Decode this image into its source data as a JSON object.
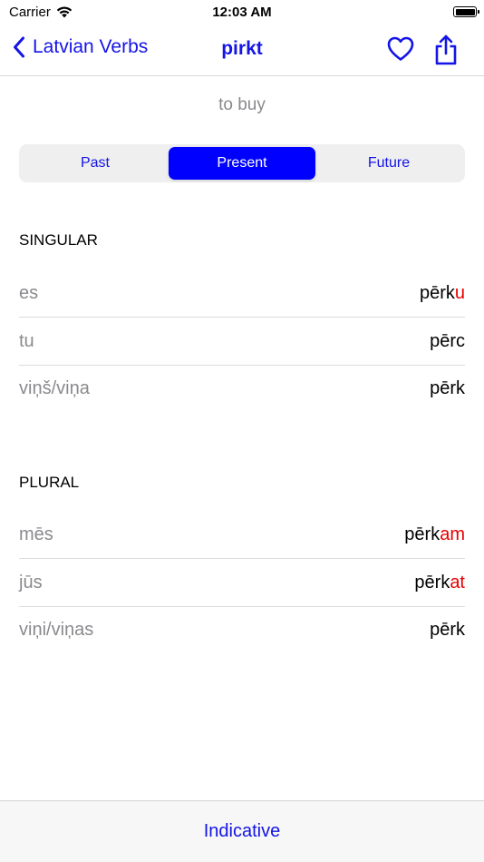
{
  "status_bar": {
    "carrier": "Carrier",
    "time": "12:03 AM"
  },
  "nav": {
    "back_label": "Latvian Verbs",
    "title": "pirkt"
  },
  "verb": {
    "translation": "to buy"
  },
  "tenses": {
    "past": "Past",
    "present": "Present",
    "future": "Future",
    "selected": "present"
  },
  "singular": {
    "header": "SINGULAR",
    "rows": [
      {
        "pronoun": "es",
        "stem": "pērk",
        "ending": "u"
      },
      {
        "pronoun": "tu",
        "stem": "pērc",
        "ending": ""
      },
      {
        "pronoun": "viņš/viņa",
        "stem": "pērk",
        "ending": ""
      }
    ]
  },
  "plural": {
    "header": "PLURAL",
    "rows": [
      {
        "pronoun": "mēs",
        "stem": "pērk",
        "ending": "am"
      },
      {
        "pronoun": "jūs",
        "stem": "pērk",
        "ending": "at"
      },
      {
        "pronoun": "viņi/viņas",
        "stem": "pērk",
        "ending": ""
      }
    ]
  },
  "bottom_bar": {
    "mood_label": "Indicative"
  },
  "colors": {
    "accent": "#1414e6",
    "selected_segment": "#0000ff",
    "ending_highlight": "#e60000",
    "secondary_text": "#8a8a8e"
  },
  "icons": {
    "back": "chevron-left-icon",
    "favorite": "heart-icon",
    "share": "share-icon",
    "wifi": "wifi-icon",
    "battery": "battery-icon"
  }
}
